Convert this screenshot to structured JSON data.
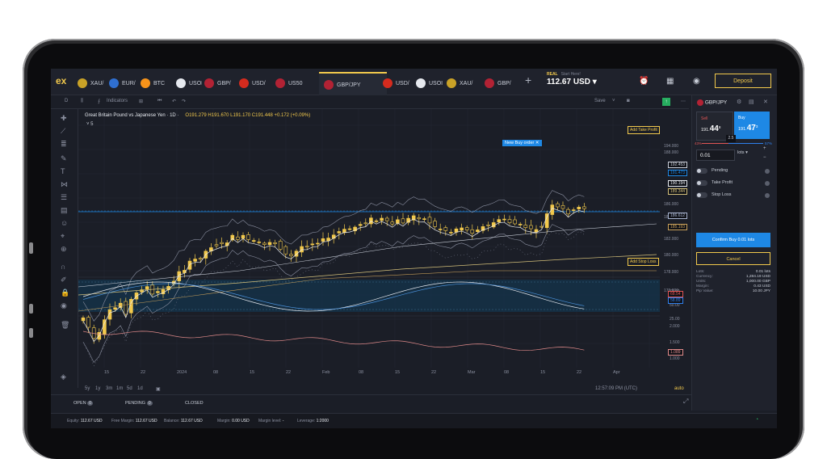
{
  "tabs": [
    {
      "label": "XAU/",
      "color": "#c9a227"
    },
    {
      "label": "EUR/",
      "color": "#2f6fd0"
    },
    {
      "label": "BTC",
      "color": "#f7931a"
    },
    {
      "label": "USOI",
      "color": "#e6e9ef"
    },
    {
      "label": "GBP/",
      "color": "#b22234"
    },
    {
      "label": "USD/",
      "color": "#d52b1e"
    },
    {
      "label": "US50",
      "color": "#b22234"
    },
    {
      "label": "GBP/JPY",
      "color": "#b22234",
      "active": true
    },
    {
      "label": "USD/",
      "color": "#d52b1e"
    },
    {
      "label": "USOI",
      "color": "#e6e9ef"
    },
    {
      "label": "XAU/",
      "color": "#c9a227"
    },
    {
      "label": "GBP/",
      "color": "#b22234"
    }
  ],
  "logo": "ex",
  "account": {
    "type": "REAL",
    "hint": "Start Here!",
    "balance": "112.67 USD ▾"
  },
  "deposit_label": "Deposit",
  "toolbar": {
    "interval": "D",
    "indicators": "Indicators",
    "save": "Save"
  },
  "chart": {
    "title": "Great Britain Pound vs Japanese Yen · 1D ·",
    "ohlc": "O191.279 H191.670 L191.170 C191.448 +0.172 (+0.09%)",
    "collapse_count": "˅ 5",
    "order_label": "New Buy order  ✕",
    "take_profit": "Add Take Profit",
    "stop_loss": "Add Stop Loss",
    "price_ticks": [
      "194.000",
      "188.000",
      "186.000",
      "184.000",
      "182.000",
      "180.000",
      "178.000",
      "176.000"
    ],
    "price_labels": [
      {
        "v": "192.453",
        "c": "#c9ced8",
        "y": 118
      },
      {
        "v": "191.473",
        "c": "#1e88e5",
        "y": 128
      },
      {
        "v": "190.194",
        "c": "#e6e9ef",
        "y": 141
      },
      {
        "v": "189.344",
        "c": "#d4c07a",
        "y": 151
      },
      {
        "v": "186.612",
        "c": "#a8b4d0",
        "y": 181
      },
      {
        "v": "185.193",
        "c": "#c9a05a",
        "y": 195
      }
    ],
    "osc_ticks": [
      "75.00",
      "50.00",
      "25.00"
    ],
    "osc_labels": [
      {
        "v": "68.54",
        "c": "#e05555"
      },
      {
        "v": "58.89",
        "c": "#2f80ed"
      }
    ],
    "osc2_ticks": [
      "2.000",
      "1.500",
      "1.000"
    ],
    "osc2_label": "1.089",
    "x_ticks": [
      "15",
      "22",
      "2024",
      "08",
      "15",
      "22",
      "Feb",
      "08",
      "15",
      "22",
      "Mar",
      "08",
      "15",
      "22",
      "Apr"
    ],
    "timeframes": [
      "5y",
      "1y",
      "3m",
      "1m",
      "5d",
      "1d"
    ],
    "clock": "12:57:09 PM (UTC)",
    "auto": "auto"
  },
  "bottom_tabs": {
    "open": "OPEN",
    "pending": "PENDING",
    "closed": "CLOSED",
    "open_count": "0",
    "pending_count": "0"
  },
  "status": {
    "equity_label": "Equity:",
    "equity": "112.67 USD",
    "free_margin_label": "Free Margin:",
    "free_margin": "112.67 USD",
    "balance_label": "Balance:",
    "balance": "112.67 USD",
    "margin_label": "Margin:",
    "margin": "0.00 USD",
    "margin_level_label": "Margin level:",
    "margin_level": "-",
    "leverage_label": "Leverage:",
    "leverage": "1:2000"
  },
  "panel": {
    "symbol": "GBP/JPY",
    "sell_label": "Sell",
    "sell_pre": "191.",
    "sell_big": "44",
    "sell_sup": "8",
    "buy_label": "Buy",
    "buy_pre": "191.",
    "buy_big": "47",
    "buy_sup": "3",
    "spread": "2.5",
    "sell_pct": "43%",
    "buy_pct": "57%",
    "buy_pct_value": 57,
    "lots_value": "0.01",
    "lots_unit": "lots ▾",
    "toggles": [
      "Pending",
      "Take Profit",
      "Stop Loss"
    ],
    "confirm": "Confirm Buy 0.01 lots",
    "cancel": "Cancel",
    "details": [
      {
        "k": "Lots:",
        "v": "0.01 lots"
      },
      {
        "k": "Currency:",
        "v": "1,284.19 USD"
      },
      {
        "k": "Units:",
        "v": "1,000.00 GBP"
      },
      {
        "k": "Margin:",
        "v": "0.43 USD"
      },
      {
        "k": "Pip Value:",
        "v": "10.00 JPY"
      }
    ]
  },
  "colors": {
    "accent": "#f2c94c",
    "buy": "#1e88e5",
    "sell": "#e05555",
    "bg": "#1b1e27"
  }
}
